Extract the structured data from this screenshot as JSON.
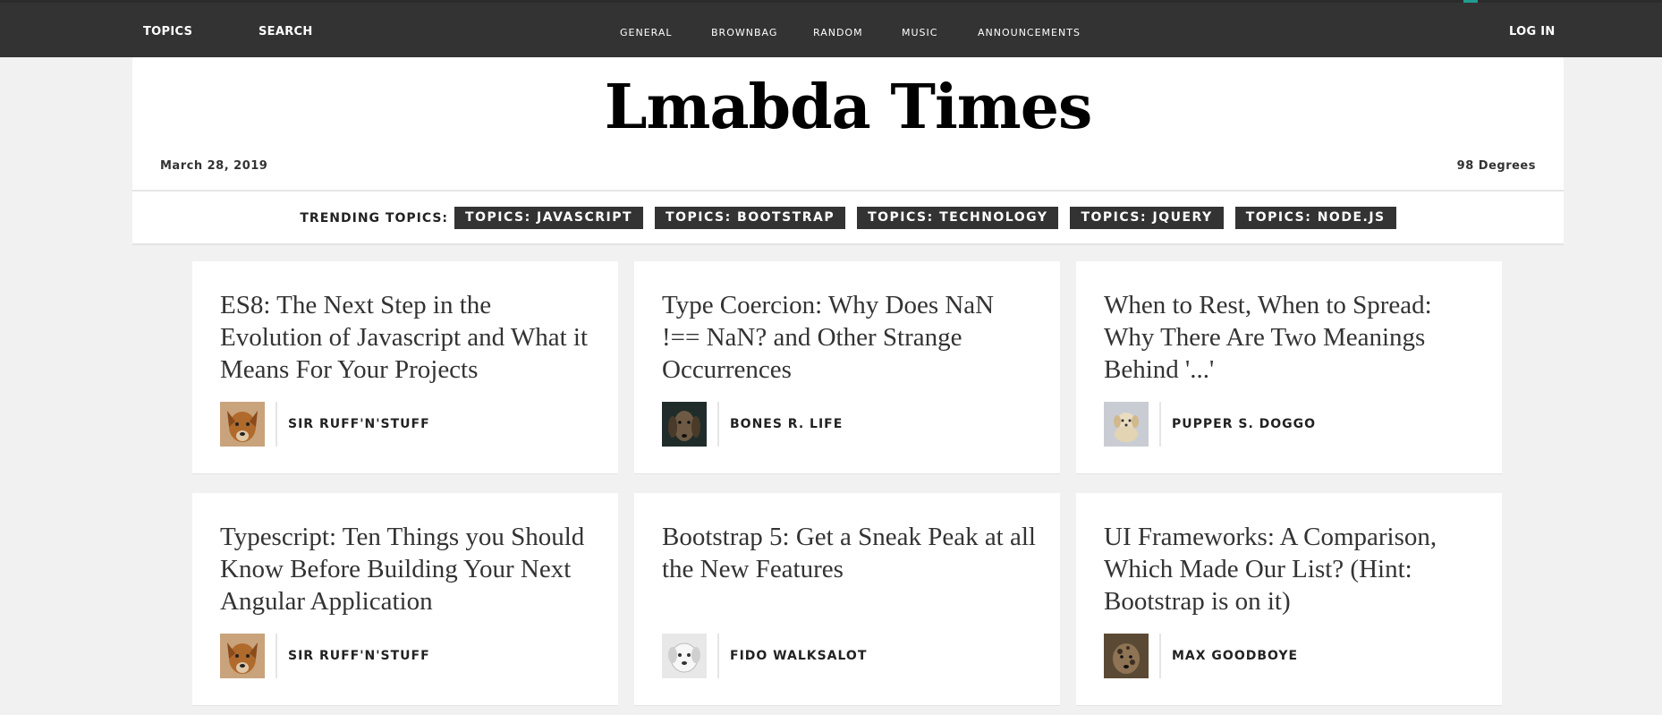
{
  "nav": {
    "topics": "TOPICS",
    "search": "SEARCH",
    "login": "LOG IN",
    "center": [
      "GENERAL",
      "BROWNBAG",
      "RANDOM",
      "MUSIC",
      "ANNOUNCEMENTS"
    ]
  },
  "header": {
    "title": "Lmabda Times",
    "date": "March 28, 2019",
    "temperature": "98 Degrees"
  },
  "trending": {
    "label": "TRENDING TOPICS:",
    "tags": [
      "TOPICS: JAVASCRIPT",
      "TOPICS: BOOTSTRAP",
      "TOPICS: TECHNOLOGY",
      "TOPICS: JQUERY",
      "TOPICS: NODE.JS"
    ]
  },
  "cards": [
    {
      "headline": "ES8: The Next Step in the Evolution of Javascript and What it Means For Your Projects",
      "author": "SIR RUFF'N'STUFF",
      "avatar_icon": "brown-dog-avatar"
    },
    {
      "headline": "Type Coercion: Why Does NaN !== NaN? and Other Strange Occurrences",
      "author": "BONES R. LIFE",
      "avatar_icon": "dark-dog-avatar"
    },
    {
      "headline": "When to Rest, When to Spread: Why There Are Two Meanings Behind '...'",
      "author": "PUPPER S. DOGGO",
      "avatar_icon": "puppy-avatar"
    },
    {
      "headline": "Typescript: Ten Things you Should Know Before Building Your Next Angular Application",
      "author": "SIR RUFF'N'STUFF",
      "avatar_icon": "brown-dog-avatar"
    },
    {
      "headline": "Bootstrap 5: Get a Sneak Peak at all the New Features",
      "author": "FIDO WALKSALOT",
      "avatar_icon": "white-dog-avatar"
    },
    {
      "headline": "UI Frameworks: A Comparison, Which Made Our List? (Hint: Bootstrap is on it)",
      "author": "MAX GOODBOYE",
      "avatar_icon": "spotted-dog-avatar"
    }
  ],
  "colors": {
    "nav_bg": "#333333",
    "page_bg": "#f1f1f1",
    "tag_bg": "#333333",
    "accent": "#1f9e8f"
  }
}
